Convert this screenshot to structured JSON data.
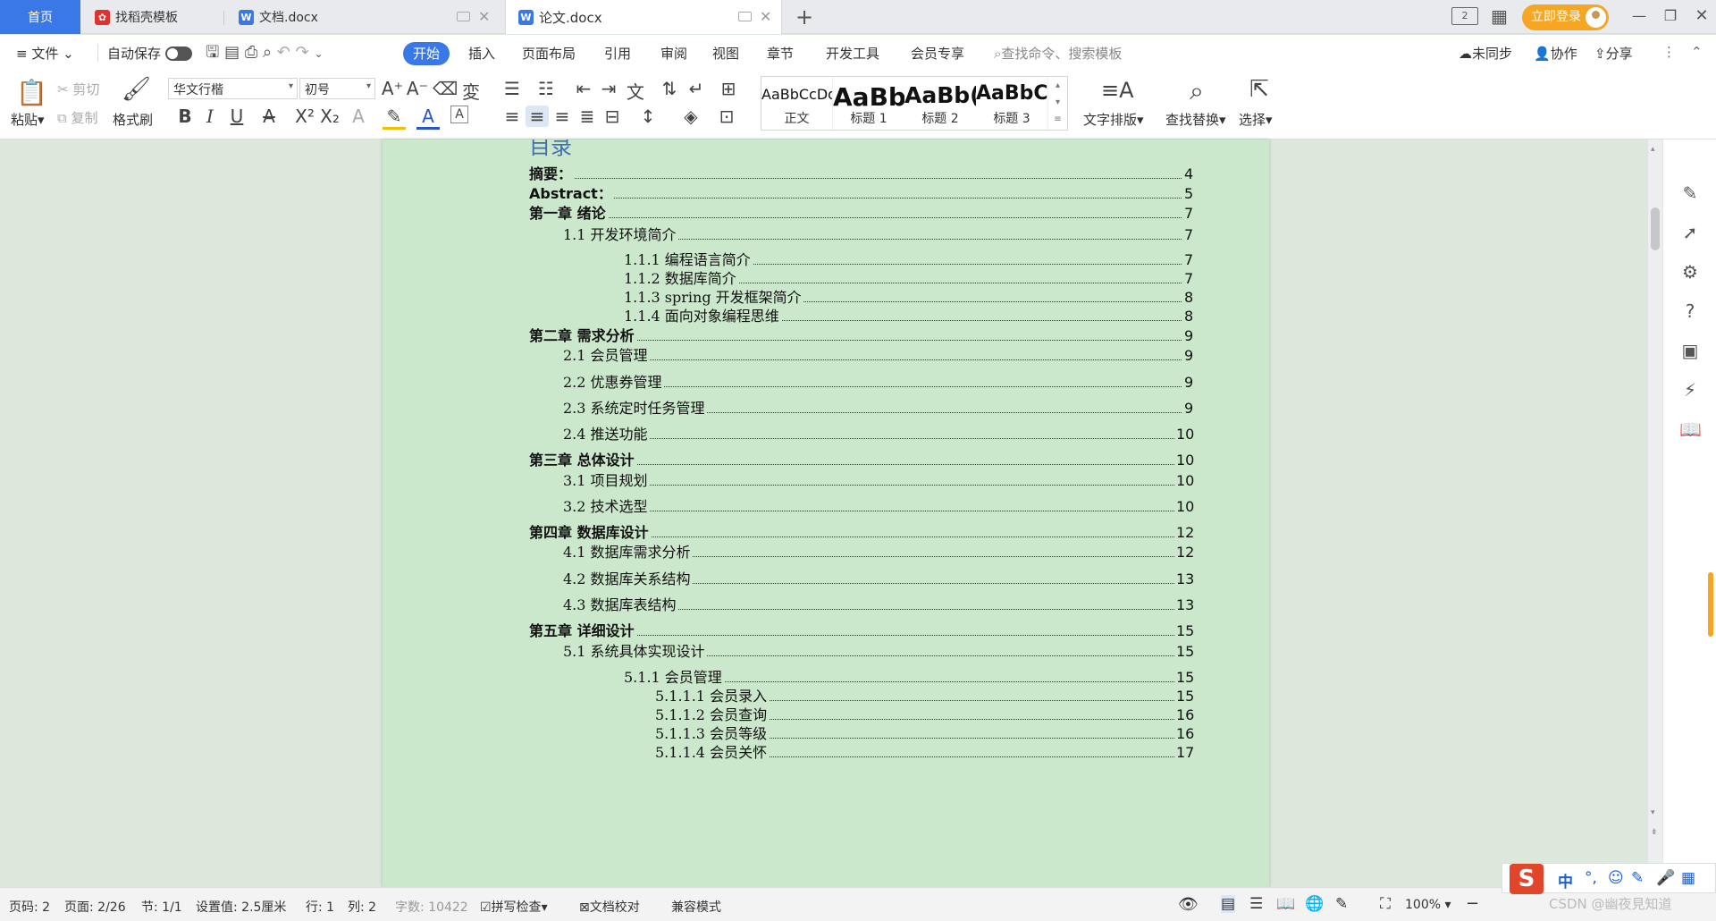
{
  "tabs": {
    "home": "首页",
    "template": "找稻壳模板",
    "doc": "文档.docx",
    "thesis": "论文.docx",
    "add": "+"
  },
  "title_right": {
    "login": "立即登录"
  },
  "menu": {
    "file": "文件",
    "autosave": "自动保存",
    "start": "开始",
    "insert": "插入",
    "layout": "页面布局",
    "references": "引用",
    "review": "审阅",
    "view": "视图",
    "chapter": "章节",
    "devtools": "开发工具",
    "member": "会员专享",
    "search_placeholder": "查找命令、搜索模板",
    "unsynced": "未同步",
    "collab": "协作",
    "share": "分享"
  },
  "ribbon": {
    "paste": "粘贴",
    "cut": "剪切",
    "copy": "复制",
    "format_painter": "格式刷",
    "font_name": "华文行楷",
    "font_size": "初号",
    "text_layout": "文字排版",
    "find_replace": "查找替换",
    "select": "选择",
    "styles": [
      {
        "preview": "AaBbCcDd",
        "label": "正文"
      },
      {
        "preview": "AaBb",
        "label": "标题 1"
      },
      {
        "preview": "AaBb(",
        "label": "标题 2"
      },
      {
        "preview": "AaBbC(",
        "label": "标题 3"
      }
    ]
  },
  "document": {
    "heading": "目录",
    "toc": [
      {
        "level": 1,
        "label": "摘要：",
        "page": "4"
      },
      {
        "level": 1,
        "label": "Abstract：",
        "page": "5"
      },
      {
        "level": 1,
        "label": "第一章  绪论",
        "page": "7"
      },
      {
        "level": 2,
        "label": "1.1 开发环境简介",
        "page": "7"
      },
      {
        "level": 3,
        "label": "1.1.1 编程语言简介",
        "page": "7"
      },
      {
        "level": 3,
        "label": "1.1.2 数据库简介",
        "page": "7"
      },
      {
        "level": 3,
        "label": "1.1.3 spring 开发框架简介",
        "page": "8"
      },
      {
        "level": 3,
        "label": "1.1.4 面向对象编程思维",
        "page": "8"
      },
      {
        "level": 1,
        "label": "第二章  需求分析",
        "page": "9"
      },
      {
        "level": 2,
        "label": "2.1 会员管理",
        "page": "9"
      },
      {
        "level": 2,
        "label": "2.2 优惠券管理",
        "page": "9"
      },
      {
        "level": 2,
        "label": "2.3 系统定时任务管理",
        "page": "9"
      },
      {
        "level": 2,
        "label": "2.4 推送功能",
        "page": "10"
      },
      {
        "level": 1,
        "label": "第三章  总体设计",
        "page": "10"
      },
      {
        "level": 2,
        "label": "3.1 项目规划",
        "page": "10"
      },
      {
        "level": 2,
        "label": "3.2 技术选型",
        "page": "10"
      },
      {
        "level": 1,
        "label": "第四章  数据库设计",
        "page": "12"
      },
      {
        "level": 2,
        "label": "4.1 数据库需求分析",
        "page": "12"
      },
      {
        "level": 2,
        "label": "4.2 数据库关系结构",
        "page": "13"
      },
      {
        "level": 2,
        "label": "4.3 数据库表结构",
        "page": "13"
      },
      {
        "level": 1,
        "label": "第五章  详细设计",
        "page": "15"
      },
      {
        "level": 2,
        "label": "5.1 系统具体实现设计",
        "page": "15"
      },
      {
        "level": 3,
        "label": "5.1.1 会员管理",
        "page": "15"
      },
      {
        "level": 4,
        "label": "5.1.1.1 会员录入",
        "page": "15"
      },
      {
        "level": 4,
        "label": "5.1.1.2 会员查询",
        "page": "16"
      },
      {
        "level": 4,
        "label": "5.1.1.3 会员等级",
        "page": "16"
      },
      {
        "level": 4,
        "label": "5.1.1.4 会员关怀",
        "page": "17"
      }
    ]
  },
  "status": {
    "page_no": "页码: 2",
    "pages": "页面: 2/26",
    "section": "节: 1/1",
    "setting": "设置值: 2.5厘米",
    "row": "行: 1",
    "col": "列: 2",
    "words": "字数: 10422",
    "spell": "拼写检查",
    "proof": "文档校对",
    "compat": "兼容模式",
    "zoom": "100%"
  },
  "ime": {
    "lang": "中"
  },
  "watermark": "CSDN @幽夜見知道"
}
